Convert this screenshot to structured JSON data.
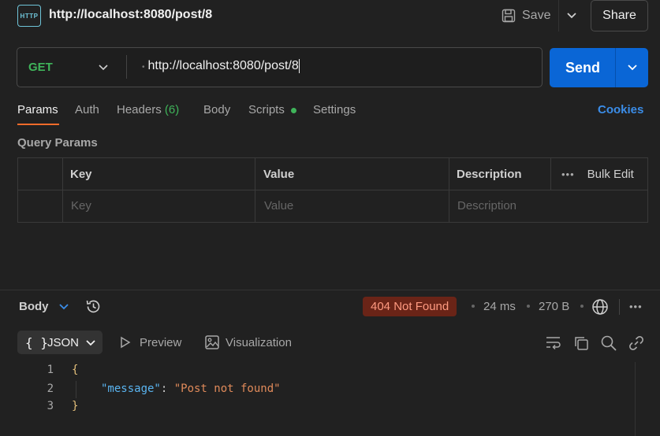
{
  "header": {
    "icon_text": "HTTP",
    "title": "http://localhost:8080/post/8",
    "save_label": "Save",
    "share_label": "Share"
  },
  "request": {
    "method": "GET",
    "url": "http://localhost:8080/post/8",
    "send_label": "Send"
  },
  "tabs": {
    "params": "Params",
    "auth": "Auth",
    "headers": "Headers",
    "headers_count": "(6)",
    "body": "Body",
    "scripts": "Scripts",
    "settings": "Settings",
    "cookies": "Cookies"
  },
  "query_params": {
    "title": "Query Params",
    "columns": [
      "Key",
      "Value",
      "Description"
    ],
    "bulk_edit": "Bulk Edit",
    "placeholders": [
      "Key",
      "Value",
      "Description"
    ]
  },
  "response": {
    "body_label": "Body",
    "status": "404 Not Found",
    "time": "24 ms",
    "size": "270 B",
    "format": "JSON",
    "preview_label": "Preview",
    "visualization_label": "Visualization",
    "lines": [
      "1",
      "2",
      "3"
    ],
    "open_brace": "{",
    "close_brace": "}",
    "key": "\"message\"",
    "colon": ": ",
    "value": "\"Post not found\""
  },
  "colors": {
    "accent_orange": "#f06b2a",
    "send_blue": "#0a66d6",
    "get_green": "#3fb45a",
    "status_bg": "#6a2417"
  },
  "icons": [
    "http-icon",
    "save-icon",
    "chevron-down-icon",
    "history-icon",
    "globe-icon",
    "more-icon",
    "preview-icon",
    "image-icon",
    "wrap-icon",
    "copy-icon",
    "search-icon",
    "link-icon"
  ]
}
